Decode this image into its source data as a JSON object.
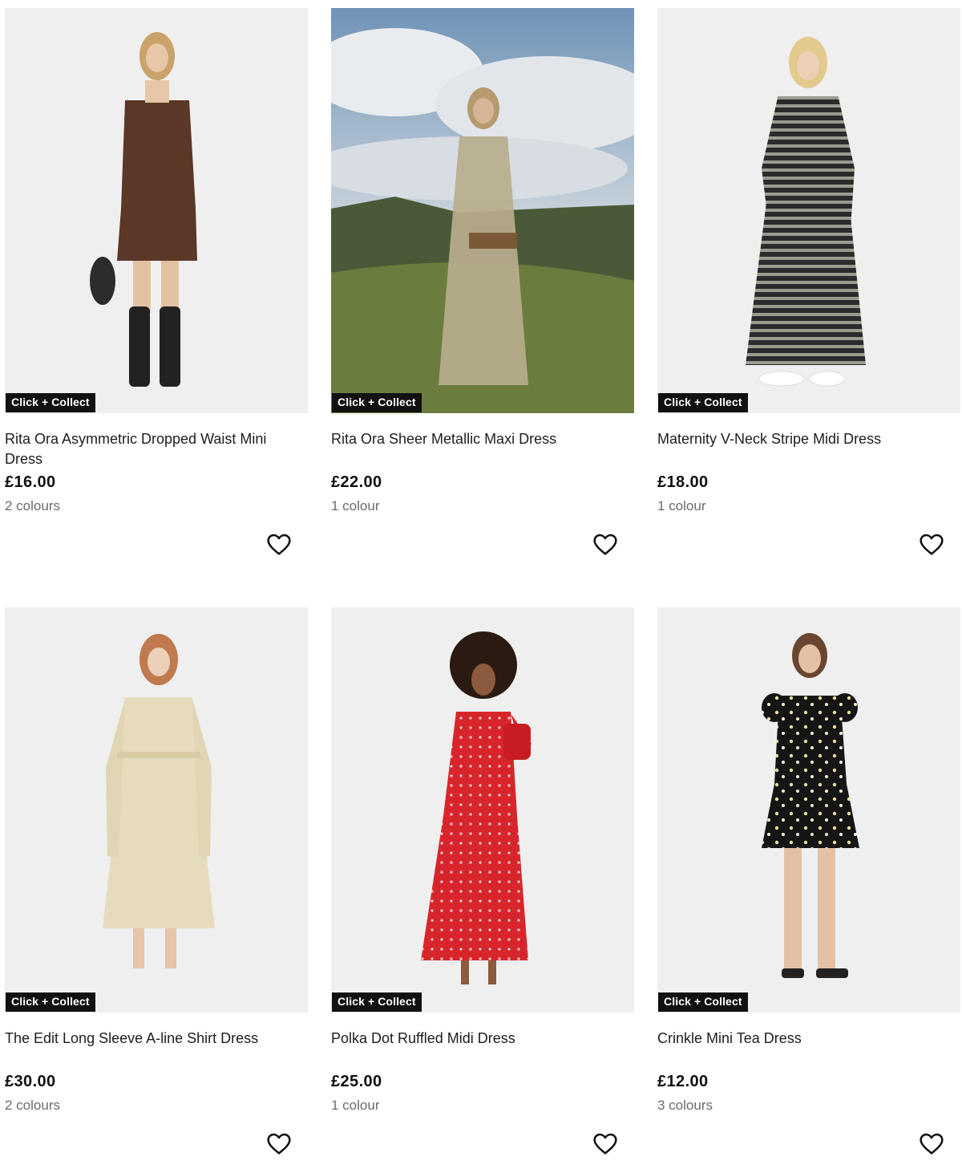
{
  "products": [
    {
      "badge": "Click + Collect",
      "title": "Rita Ora Asymmetric Dropped Waist Mini Dress",
      "price": "£16.00",
      "colours": "2 colours"
    },
    {
      "badge": "Click + Collect",
      "title": "Rita Ora Sheer Metallic Maxi Dress",
      "price": "£22.00",
      "colours": "1 colour"
    },
    {
      "badge": "Click + Collect",
      "title": "Maternity V-Neck Stripe Midi Dress",
      "price": "£18.00",
      "colours": "1 colour"
    },
    {
      "badge": "Click + Collect",
      "title": "The Edit Long Sleeve A-line Shirt Dress",
      "price": "£30.00",
      "colours": "2 colours"
    },
    {
      "badge": "Click + Collect",
      "title": "Polka Dot Ruffled Midi Dress",
      "price": "£25.00",
      "colours": "1 colour"
    },
    {
      "badge": "Click + Collect",
      "title": "Crinkle Mini Tea Dress",
      "price": "£12.00",
      "colours": "3 colours"
    }
  ],
  "icons": {
    "favourite": "heart-outline-icon"
  },
  "colors": {
    "badge_bg": "#111111",
    "badge_text": "#ffffff",
    "image_bg": "#eeeeee",
    "muted_text": "#6b6b6b"
  }
}
